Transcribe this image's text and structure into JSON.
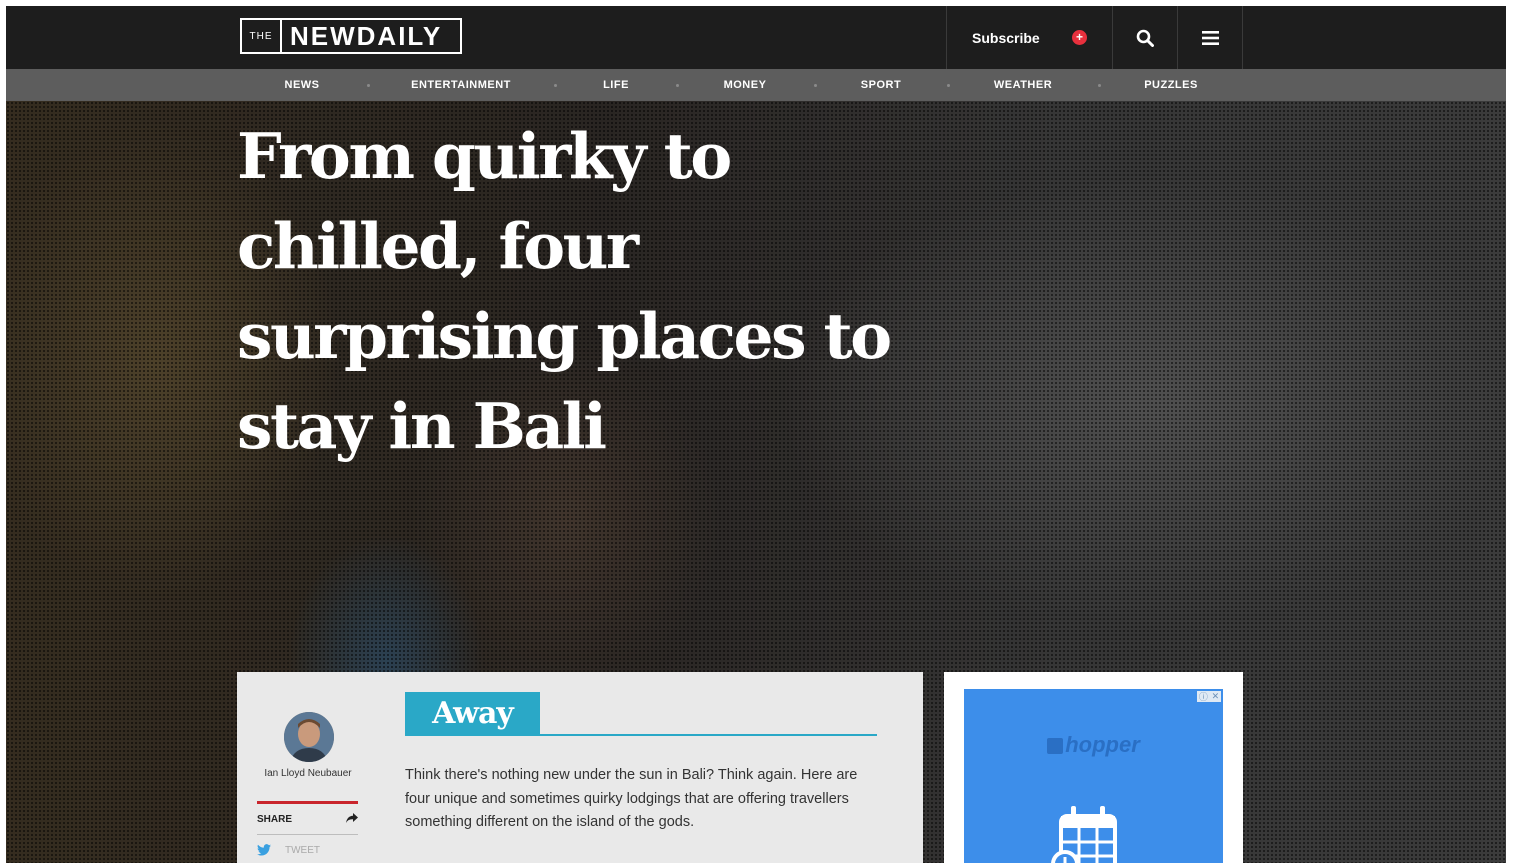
{
  "header": {
    "logo_prefix": "THE",
    "logo_main": "NEWDAILY",
    "subscribe_label": "Subscribe",
    "icons": [
      "plus-circle-icon",
      "search-icon",
      "menu-icon"
    ],
    "accent_color": "#e8303d"
  },
  "nav": {
    "items": [
      "NEWS",
      "ENTERTAINMENT",
      "LIFE",
      "MONEY",
      "SPORT",
      "WEATHER",
      "PUZZLES"
    ]
  },
  "article": {
    "headline": "From quirky to chilled, four surprising places to stay in Bali",
    "author": "Ian Lloyd Neubauer",
    "share_label": "SHARE",
    "tweet_label": "TWEET",
    "section": "Away",
    "section_color": "#2aa8c7",
    "intro": "Think there's nothing new under the sun in Bali? Think again. Here are four unique and sometimes quirky lodgings that are offering travellers something different on the island of the gods."
  },
  "ad": {
    "brand": "hopper",
    "choices_icons": [
      "adchoices-icon",
      "close-icon"
    ],
    "icon": "calendar-clock-icon",
    "background_color": "#3d8eea"
  }
}
